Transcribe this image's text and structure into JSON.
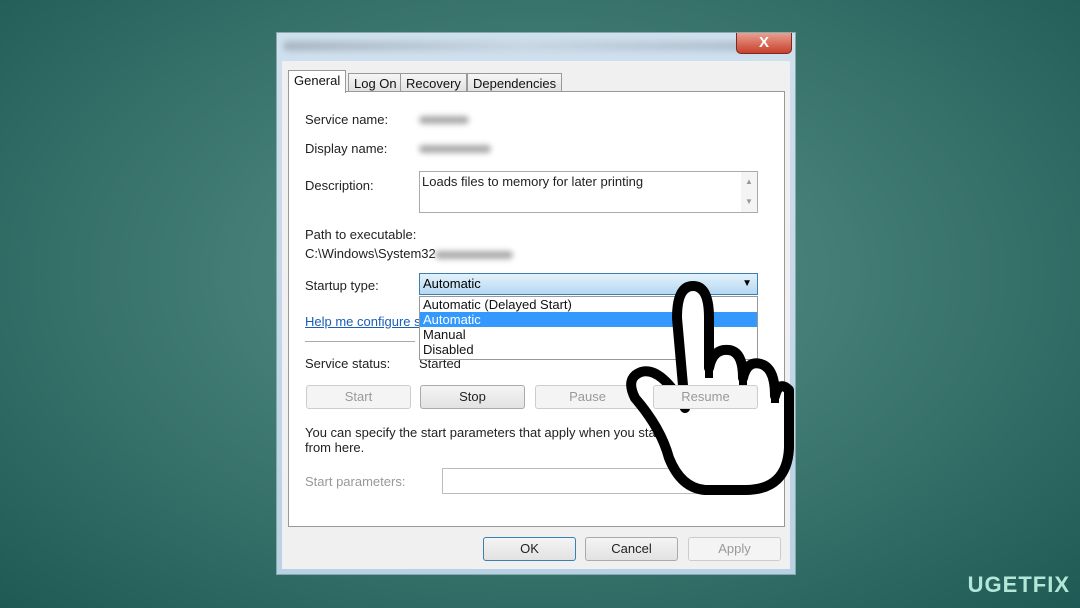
{
  "window": {
    "close_glyph": "X"
  },
  "tabs": [
    {
      "label": "General",
      "active": true
    },
    {
      "label": "Log On"
    },
    {
      "label": "Recovery"
    },
    {
      "label": "Dependencies"
    }
  ],
  "general": {
    "service_name_label": "Service name:",
    "display_name_label": "Display name:",
    "description_label": "Description:",
    "description_value": "Loads files to memory for later printing",
    "path_label": "Path to executable:",
    "path_value": "C:\\Windows\\System32",
    "startup_type_label": "Startup type:",
    "startup_type_value": "Automatic",
    "startup_options": [
      "Automatic (Delayed Start)",
      "Automatic",
      "Manual",
      "Disabled"
    ],
    "help_link": "Help me configure s",
    "service_status_label": "Service status:",
    "service_status_value": "Started",
    "buttons": {
      "start": "Start",
      "stop": "Stop",
      "pause": "Pause",
      "resume": "Resume"
    },
    "params_note": "You can specify the start parameters that apply when you start the service from here.",
    "start_params_label": "Start parameters:",
    "start_params_value": ""
  },
  "footer": {
    "ok": "OK",
    "cancel": "Cancel",
    "apply": "Apply"
  },
  "watermark": "UGETFIX",
  "colors": {
    "highlight": "#3399ff",
    "link": "#1a5fb4"
  }
}
